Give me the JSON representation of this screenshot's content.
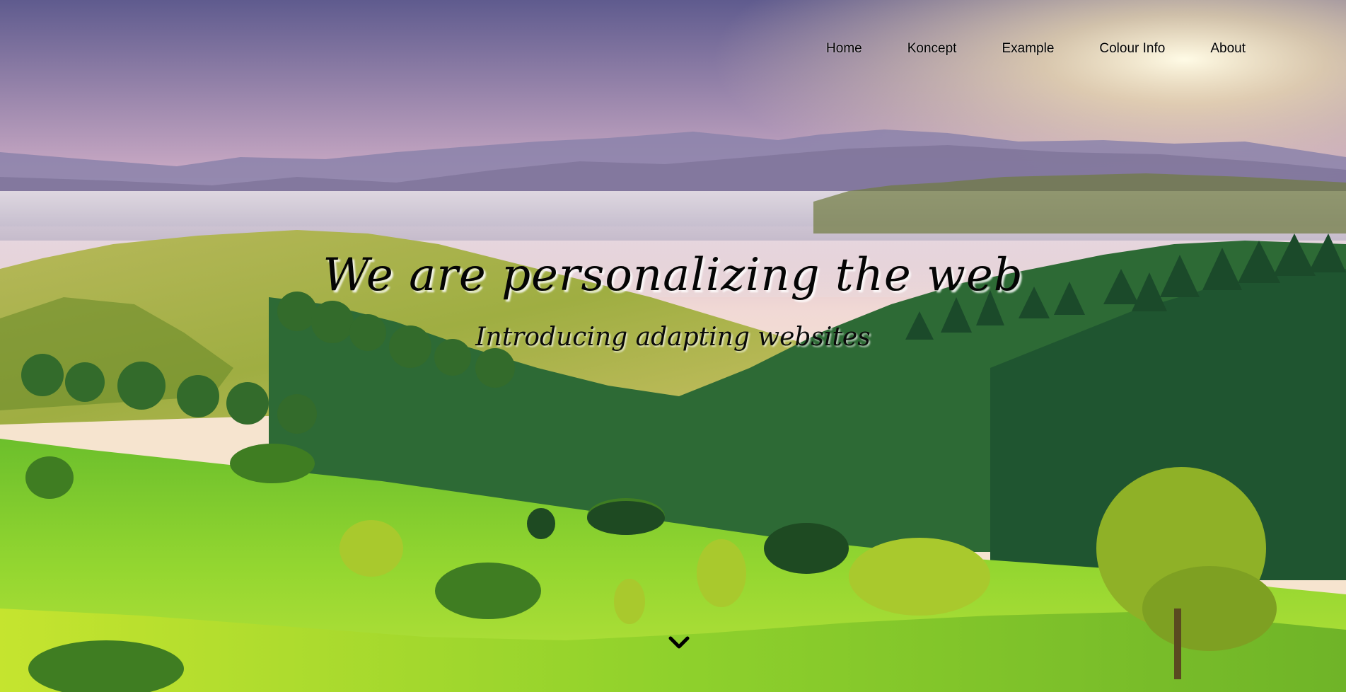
{
  "nav": {
    "items": [
      {
        "label": "Home"
      },
      {
        "label": "Koncept"
      },
      {
        "label": "Example"
      },
      {
        "label": "Colour Info"
      },
      {
        "label": "About"
      }
    ]
  },
  "hero": {
    "title": "We are personalizing the web",
    "subtitle": "Introducing adapting websites",
    "scroll_icon": "chevron-down-icon",
    "background": "landscape-photo"
  },
  "colors": {
    "sky_top": "#6f6a9a",
    "sky_mid": "#e8c6d2",
    "sun": "#fff6d2",
    "mountain_far": "#8f86ad",
    "hill_mid": "#a7ad4e",
    "grass_front": "#7fd12a",
    "forest": "#1f5a2c",
    "text": "#000000"
  }
}
